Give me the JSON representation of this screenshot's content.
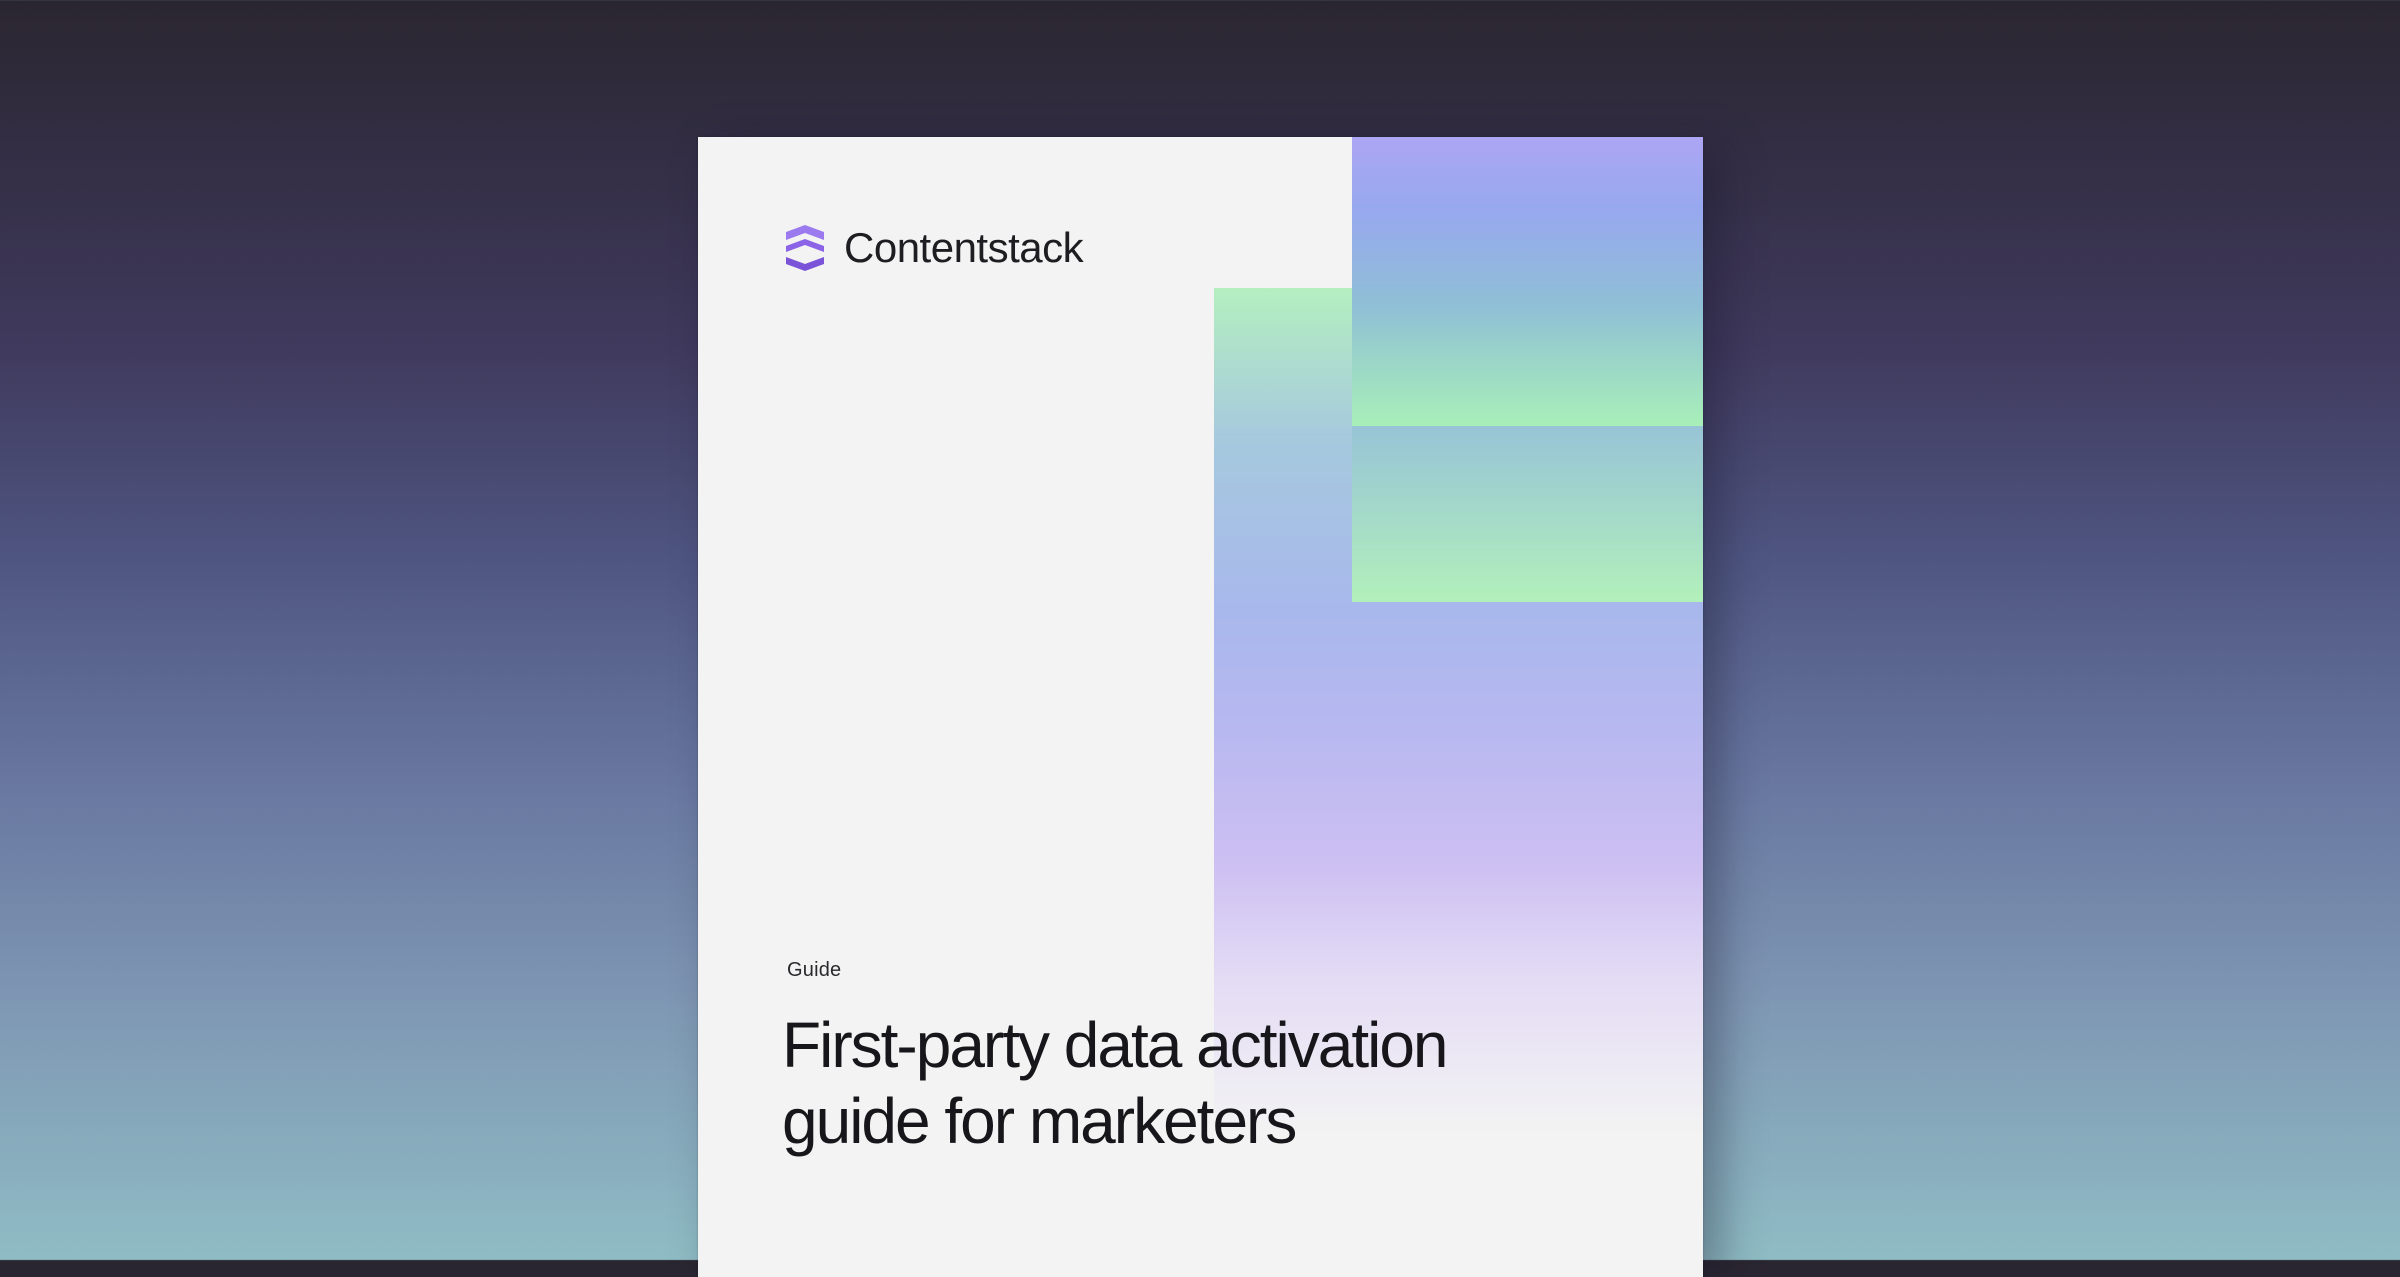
{
  "brand": {
    "name": "Contentstack",
    "logo_icon": "contentstack-logo-icon",
    "logo_color": "#8a63e6"
  },
  "cover": {
    "kicker": "Guide",
    "title": "First-party data activation guide for marketers"
  },
  "colors": {
    "background_top": "#2a2630",
    "background_bottom": "#8fbcc4",
    "paper": "#f3f3f3",
    "accent_green": "#b2f0bb",
    "accent_lavender": "#ada6f4"
  }
}
